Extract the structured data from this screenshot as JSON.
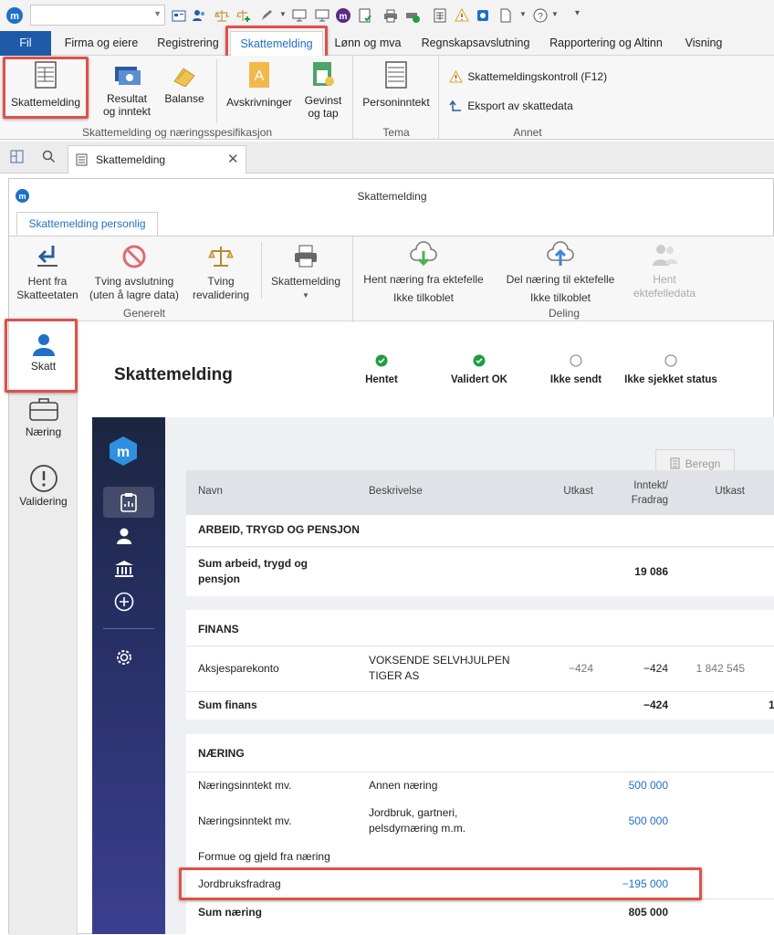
{
  "menu": {
    "file": "Fil",
    "items": [
      "Firma og eiere",
      "Registrering",
      "Skattemelding",
      "Lønn og mva",
      "Regnskapsavslutning",
      "Rapportering og Altinn",
      "Visning"
    ]
  },
  "ribbon": {
    "skattemelding": "Skattemelding",
    "resultat_1": "Resultat",
    "resultat_2": "og inntekt",
    "balanse": "Balanse",
    "avskrivninger": "Avskrivninger",
    "gevinst_1": "Gevinst",
    "gevinst_2": "og tap",
    "personinntekt": "Personinntekt",
    "kontroll": "Skattemeldingskontroll (F12)",
    "eksport": "Eksport av skattedata",
    "group1": "Skattemelding og næringsspesifikasjon",
    "group2": "Tema",
    "group3": "Annet"
  },
  "tabstrip": {
    "doc_tab": "Skattemelding"
  },
  "window": {
    "title": "Skattemelding",
    "tab": "Skattemelding personlig"
  },
  "inner_ribbon": {
    "hent_1": "Hent fra",
    "hent_2": "Skatteetaten",
    "tving_1": "Tving avslutning",
    "tving_2": "(uten å lagre data)",
    "reval_1": "Tving",
    "reval_2": "revalidering",
    "skm": "Skattemelding",
    "hent_naering": "Hent næring fra ektefelle",
    "hent_status": "Ikke tilkoblet",
    "del_naering": "Del næring til ektefelle",
    "del_status": "Ikke tilkoblet",
    "hent_ekt_1": "Hent",
    "hent_ekt_2": "ektefelledata",
    "group_generelt": "Generelt",
    "group_deling": "Deling"
  },
  "sidebar": {
    "skatt": "Skatt",
    "naering": "Næring",
    "validering": "Validering"
  },
  "page": {
    "title": "Skattemelding"
  },
  "status": [
    "Hentet",
    "Validert OK",
    "Ikke sendt",
    "Ikke sjekket status"
  ],
  "beregn": "Beregn",
  "table": {
    "headers": {
      "navn": "Navn",
      "beskrivelse": "Beskrivelse",
      "utkast": "Utkast",
      "inntekt_1": "Inntekt/",
      "inntekt_2": "Fradrag",
      "utkast2": "Utkast"
    },
    "sec1": {
      "title": "ARBEID, TRYGD OG PENSJON",
      "sum_1": "Sum arbeid, trygd og",
      "sum_2": "pensjon",
      "sum_val": "19 086"
    },
    "sec2": {
      "title": "FINANS",
      "row_name": "Aksjesparekonto",
      "row_desc_1": "VOKSENDE SELVHJULPEN",
      "row_desc_2": "TIGER AS",
      "row_utkast": "−424",
      "row_inntekt": "−424",
      "row_utkast2": "1 842 545",
      "sum": "Sum finans",
      "sum_val": "−424",
      "sum_trunc": "1"
    },
    "sec3": {
      "title": "NÆRING",
      "r1_name": "Næringsinntekt mv.",
      "r1_desc": "Annen næring",
      "r1_val": "500 000",
      "r2_name": "Næringsinntekt mv.",
      "r2_desc_1": "Jordbruk, gartneri,",
      "r2_desc_2": "pelsdyrnæring m.m.",
      "r2_val": "500 000",
      "r3_name": "Formue og gjeld fra næring",
      "r4_name": "Jordbruksfradrag",
      "r4_val": "−195 000",
      "sum": "Sum næring",
      "sum_val": "805 000"
    }
  },
  "colors": {
    "accent": "#1f6fc9",
    "file_tab": "#1e5aa8",
    "nav_top": "#1b2640",
    "nav_bottom": "#3b3f8f",
    "highlight": "#e0504a",
    "ok_green": "#1e9e3e"
  }
}
